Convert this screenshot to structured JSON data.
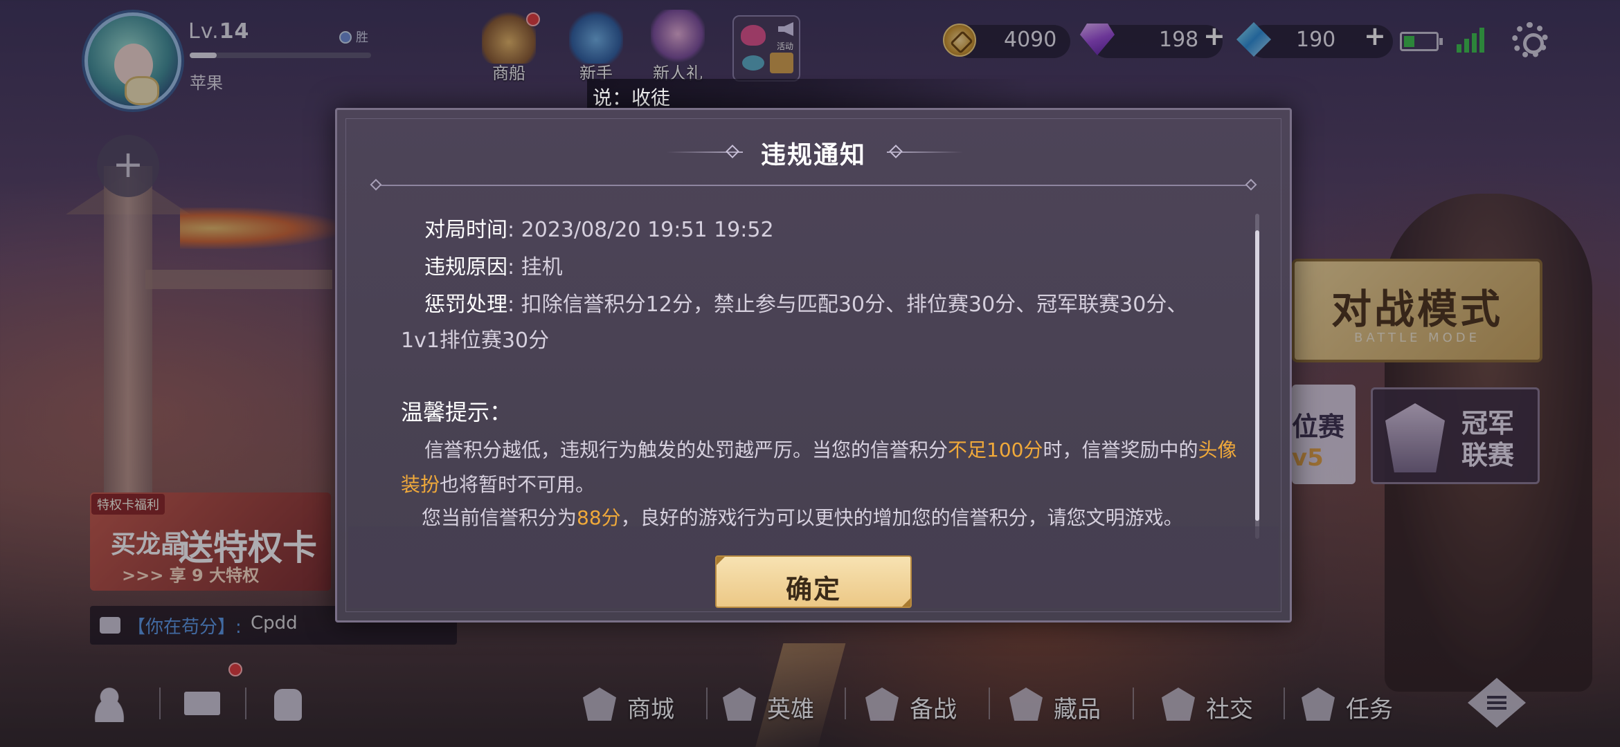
{
  "profile": {
    "level_prefix": "Lv.",
    "level": "14",
    "xp_fraction": 0.15,
    "rank_badge": "胜",
    "username": "苹果"
  },
  "top_nav": {
    "items": [
      {
        "label": "商船",
        "icon": "ship-icon"
      },
      {
        "label": "新手",
        "icon": "book-icon"
      },
      {
        "label": "新人礼",
        "icon": "newbie-gift-icon"
      }
    ],
    "event_label": "活动"
  },
  "currencies": {
    "gold": "4090",
    "diamond": "198",
    "crystal": "190"
  },
  "status": {
    "battery_fraction": 0.3,
    "colors": {
      "battery": "#39c34a",
      "signal": "#39c34a"
    }
  },
  "broadcast": {
    "text": "说：收徒"
  },
  "right_panel": {
    "battle_mode_title": "对战模式",
    "battle_mode_subtitle": "BATTLE MODE",
    "ranked_label": "位赛",
    "ranked_sub": "v5",
    "champion_line1": "冠军",
    "champion_line2": "联赛"
  },
  "promo": {
    "tag": "特权卡福利",
    "line1": "买龙晶",
    "line2": "送特权卡",
    "line3": ">>> 享 9 大特权"
  },
  "chat": {
    "channel": "【你在苟分】:",
    "message": "Cpdd"
  },
  "bottom_nav": {
    "items": [
      "商城",
      "英雄",
      "备战",
      "藏品",
      "社交",
      "任务"
    ]
  },
  "modal": {
    "title": "违规通知",
    "match_time_label": "对局时间",
    "match_time_value": ": 2023/08/20 19:51 19:52",
    "reason_label": "违规原因",
    "reason_value": ": 挂机",
    "penalty_label": "惩罚处理",
    "penalty_value": ": 扣除信誉积分12分，禁止参与匹配30分、排位赛30分、冠军联赛30分、",
    "penalty_value_cont": "1v1排位赛30分",
    "tips_title": "温馨提示：",
    "tip1_a": "信誉积分越低，违规行为触发的处罚越严厉。当您的信誉积分",
    "tip1_hl1": "不足100分",
    "tip1_b": "时，信誉奖励中的",
    "tip1_hl2": "头像",
    "tip1_hl3": "装扮",
    "tip1_c": "也将暂时不可用。",
    "tip2_a": "您当前信誉积分为",
    "tip2_hl": "88分",
    "tip2_b": "，良好的游戏行为可以更快的增加您的信誉积分，请您文明游戏。",
    "confirm_label": "确定",
    "highlight_color": "#f0a93a"
  }
}
